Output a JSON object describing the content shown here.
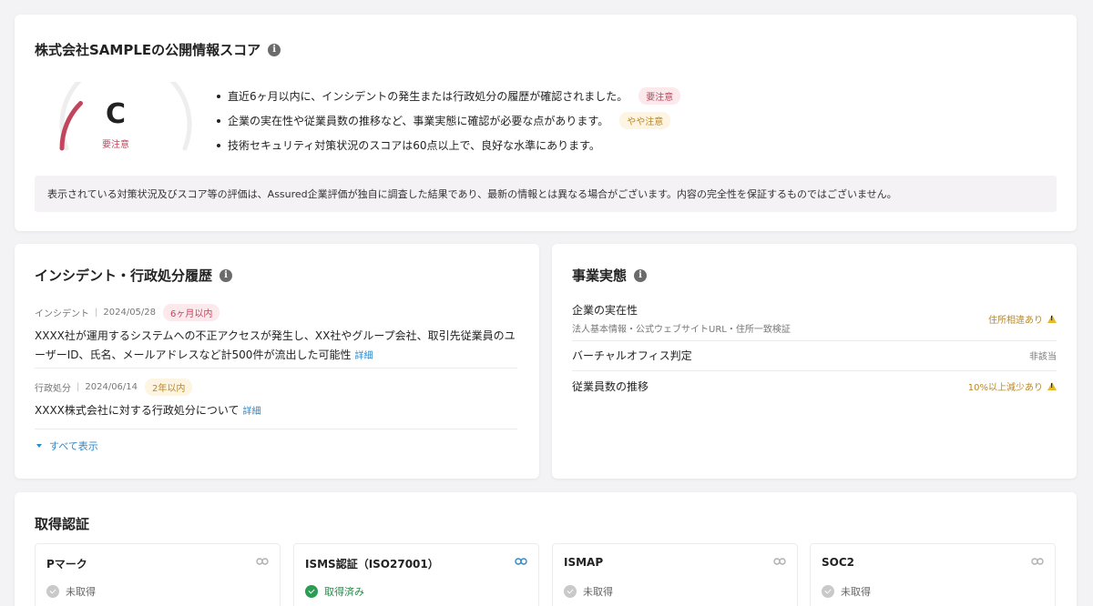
{
  "score_card": {
    "title": "株式会社SAMPLEの公開情報スコア",
    "grade": "C",
    "grade_label": "要注意",
    "score_fraction": 0.25,
    "bullets": [
      {
        "text": "直近6ヶ月以内に、インシデントの発生または行政処分の履歴が確認されました。",
        "badge": "要注意",
        "badge_color": "#c2455e"
      },
      {
        "text": "企業の実在性や従業員数の推移など、事業実態に確認が必要な点があります。",
        "badge": "やや注意",
        "badge_color": "#b9882a"
      },
      {
        "text": "技術セキュリティ対策状況のスコアは60点以上で、良好な水準にあります。",
        "badge": ""
      }
    ],
    "disclaimer": "表示されている対策状況及びスコア等の評価は、Assured企業評価が独自に調査した結果であり、最新の情報とは異なる場合がございます。内容の完全性を保証するものではございません。"
  },
  "incident_card": {
    "title": "インシデント・行政処分履歴",
    "items": [
      {
        "type": "インシデント",
        "date": "2024/05/28",
        "tag": "6ヶ月以内",
        "text": "XXXX社が運用するシステムへの不正アクセスが発生し、XX社やグループ会社、取引先従業員のユーザーID、氏名、メールアドレスなど計500件が流出した可能性",
        "link": "詳細"
      },
      {
        "type": "行政処分",
        "date": "2024/06/14",
        "tag": "2年以内",
        "text": "XXXX株式会社に対する行政処分について",
        "link": "詳細"
      }
    ],
    "show_all": "すべて表示"
  },
  "business_card": {
    "title": "事業実態",
    "rows": [
      {
        "label": "企業の実在性",
        "sub": "法人基本情報・公式ウェブサイトURL・住所一致検証",
        "value": "住所相違あり",
        "warn": true
      },
      {
        "label": "バーチャルオフィス判定",
        "sub": "",
        "value": "非該当",
        "warn": false
      },
      {
        "label": "従業員数の推移",
        "sub": "",
        "value": "10%以上減少あり",
        "warn": true
      }
    ]
  },
  "cert_card": {
    "title": "取得認証",
    "items": [
      {
        "name": "Pマーク",
        "status": "未取得",
        "acquired": false
      },
      {
        "name": "ISMS認証（ISO27001）",
        "status": "取得済み",
        "acquired": true
      },
      {
        "name": "ISMAP",
        "status": "未取得",
        "acquired": false
      },
      {
        "name": "SOC2",
        "status": "未取得",
        "acquired": false
      }
    ]
  },
  "colors": {
    "danger": "#c2455e",
    "caution": "#b9882a",
    "link": "#2f88c9",
    "success": "#2a9d52"
  },
  "icons": [
    "info-icon",
    "warning-icon",
    "link-icon",
    "check-circle-icon",
    "caret-down-icon"
  ]
}
